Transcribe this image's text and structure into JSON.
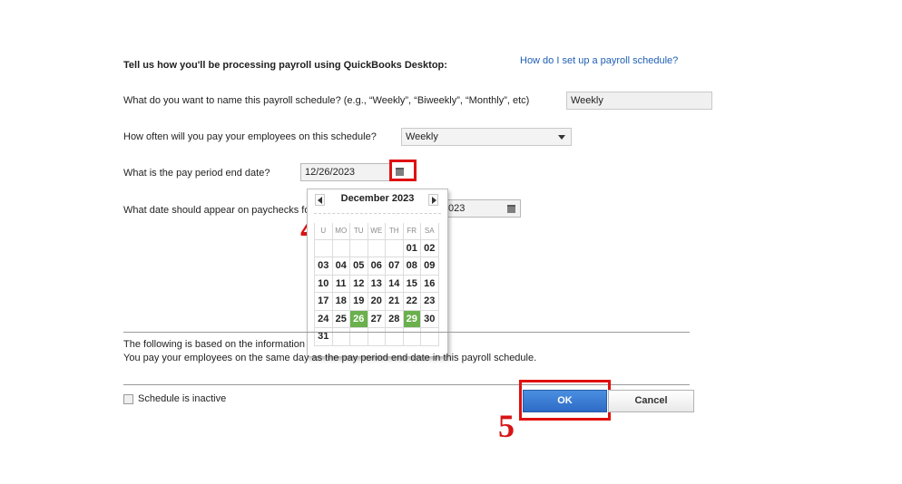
{
  "form": {
    "heading": "Tell us how you'll be processing payroll using QuickBooks Desktop:",
    "help_link": "How do I set up a payroll schedule?",
    "q_name": "What do you want to name this payroll schedule? (e.g., “Weekly”, “Biweekly”, “Monthly”, etc)",
    "name_value": "Weekly",
    "q_frequency": "How often will you pay your employees on this schedule?",
    "frequency_value": "Weekly",
    "q_period_end": "What is the pay period end date?",
    "period_end_value": "12/26/2023",
    "q_paycheck_date": "What date should appear on paychecks fo",
    "paycheck_date_value": "023"
  },
  "calendar": {
    "month_title": "December 2023",
    "weekdays": [
      "U",
      "MO",
      "TU",
      "WE",
      "TH",
      "FR",
      "SA"
    ],
    "weeks": [
      [
        "",
        "",
        "",
        "",
        "",
        "01",
        "02"
      ],
      [
        "03",
        "04",
        "05",
        "06",
        "07",
        "08",
        "09"
      ],
      [
        "10",
        "11",
        "12",
        "13",
        "14",
        "15",
        "16"
      ],
      [
        "17",
        "18",
        "19",
        "20",
        "21",
        "22",
        "23"
      ],
      [
        "24",
        "25",
        "26",
        "27",
        "28",
        "29",
        "30"
      ],
      [
        "31",
        "",
        "",
        "",
        "",
        "",
        ""
      ]
    ],
    "highlighted_days": [
      "26",
      "29"
    ],
    "highlight_color": "#6ab04c"
  },
  "info": {
    "line1": "The following is based on the information",
    "line2": "You pay your employees on the same day as the pay period end date in this payroll schedule."
  },
  "footer": {
    "inactive_label": "Schedule is inactive",
    "ok_label": "OK",
    "cancel_label": "Cancel"
  },
  "annotations": {
    "step4": "4",
    "step5": "5",
    "box_color": "#e01010"
  }
}
